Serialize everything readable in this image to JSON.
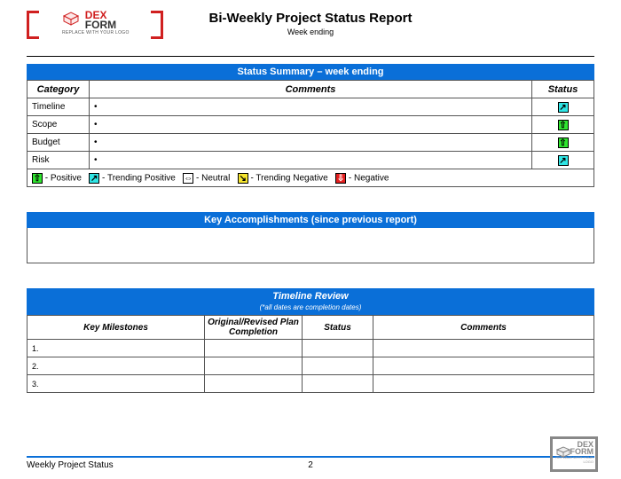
{
  "logo": {
    "brand1": "DEX",
    "brand2": "FORM",
    "tagline": "REPLACE WITH YOUR LOGO"
  },
  "title": "Bi-Weekly Project Status Report",
  "subtitle": "Week ending",
  "summary": {
    "header": "Status Summary – week ending",
    "cols": {
      "category": "Category",
      "comments": "Comments",
      "status": "Status"
    },
    "rows": [
      {
        "cat": "Timeline",
        "comment": "•",
        "status": "tpos"
      },
      {
        "cat": "Scope",
        "comment": "•",
        "status": "pos"
      },
      {
        "cat": "Budget",
        "comment": "•",
        "status": "pos"
      },
      {
        "cat": "Risk",
        "comment": "•",
        "status": "tpos"
      }
    ]
  },
  "legend": {
    "pos": {
      "label": "- Positive",
      "glyph": "⇧"
    },
    "tpos": {
      "label": "- Trending Positive",
      "glyph": "↗"
    },
    "neu": {
      "label": "- Neutral",
      "glyph": "⇔"
    },
    "tneg": {
      "label": "- Trending Negative",
      "glyph": "↘"
    },
    "neg": {
      "label": "- Negative",
      "glyph": "⇩"
    }
  },
  "accomp": {
    "header": "Key Accomplishments (since previous report)"
  },
  "timeline": {
    "header": "Timeline Review",
    "subheader": "(*all dates are completion dates)",
    "cols": {
      "milestones": "Key Milestones",
      "plan": "Original/Revised Plan Completion",
      "status": "Status",
      "comments": "Comments"
    },
    "rows": [
      {
        "n": "1."
      },
      {
        "n": "2."
      },
      {
        "n": "3."
      }
    ]
  },
  "footer": {
    "left": "Weekly Project Status",
    "page": "2"
  }
}
